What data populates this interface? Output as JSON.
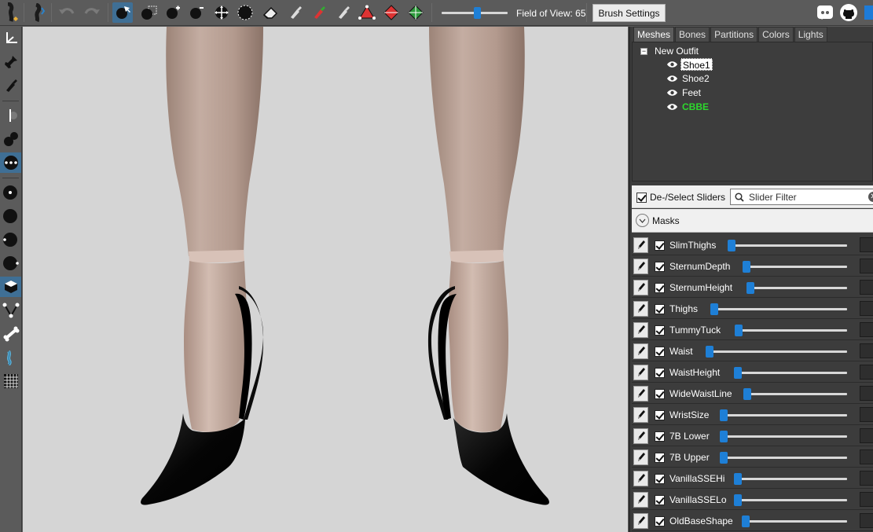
{
  "toolbar": {
    "fov_label": "Field of View: 65",
    "fov_value": 65,
    "brush_settings_label": "Brush Settings"
  },
  "tabs": [
    {
      "label": "Meshes",
      "active": true
    },
    {
      "label": "Bones",
      "active": false
    },
    {
      "label": "Partitions",
      "active": false
    },
    {
      "label": "Colors",
      "active": false
    },
    {
      "label": "Lights",
      "active": false
    }
  ],
  "tree": {
    "root_label": "New Outfit",
    "items": [
      {
        "label": "Shoe1",
        "selected": true,
        "color": "#ffffff"
      },
      {
        "label": "Shoe2",
        "selected": false,
        "color": "#ffffff"
      },
      {
        "label": "Feet",
        "selected": false,
        "color": "#ffffff"
      },
      {
        "label": "CBBE",
        "selected": false,
        "color": "#2dd82d"
      }
    ]
  },
  "slider_panel": {
    "deselect_label": "De-/Select Sliders",
    "filter_placeholder": "Slider Filter",
    "masks_label": "Masks"
  },
  "sliders": [
    {
      "name": "SlimThighs",
      "value": 0.0
    },
    {
      "name": "SternumDepth",
      "value": 0.0
    },
    {
      "name": "SternumHeight",
      "value": 0.0
    },
    {
      "name": "Thighs",
      "value": 0.0
    },
    {
      "name": "TummyTuck",
      "value": 0.0
    },
    {
      "name": "Waist",
      "value": 0.0
    },
    {
      "name": "WaistHeight",
      "value": 0.0
    },
    {
      "name": "WideWaistLine",
      "value": 0.0
    },
    {
      "name": "WristSize",
      "value": 0.0
    },
    {
      "name": "7B Lower",
      "value": 0.0
    },
    {
      "name": "7B Upper",
      "value": 0.0
    },
    {
      "name": "VanillaSSEHi",
      "value": 0.0
    },
    {
      "name": "VanillaSSELo",
      "value": 0.0
    },
    {
      "name": "OldBaseShape",
      "value": 0.0
    }
  ],
  "colors": {
    "accent": "#1e7fd6",
    "active_tool": "#3f6f95",
    "viewport_bg": "#d5d5d5",
    "mesh_highlight": "#2dd82d"
  }
}
